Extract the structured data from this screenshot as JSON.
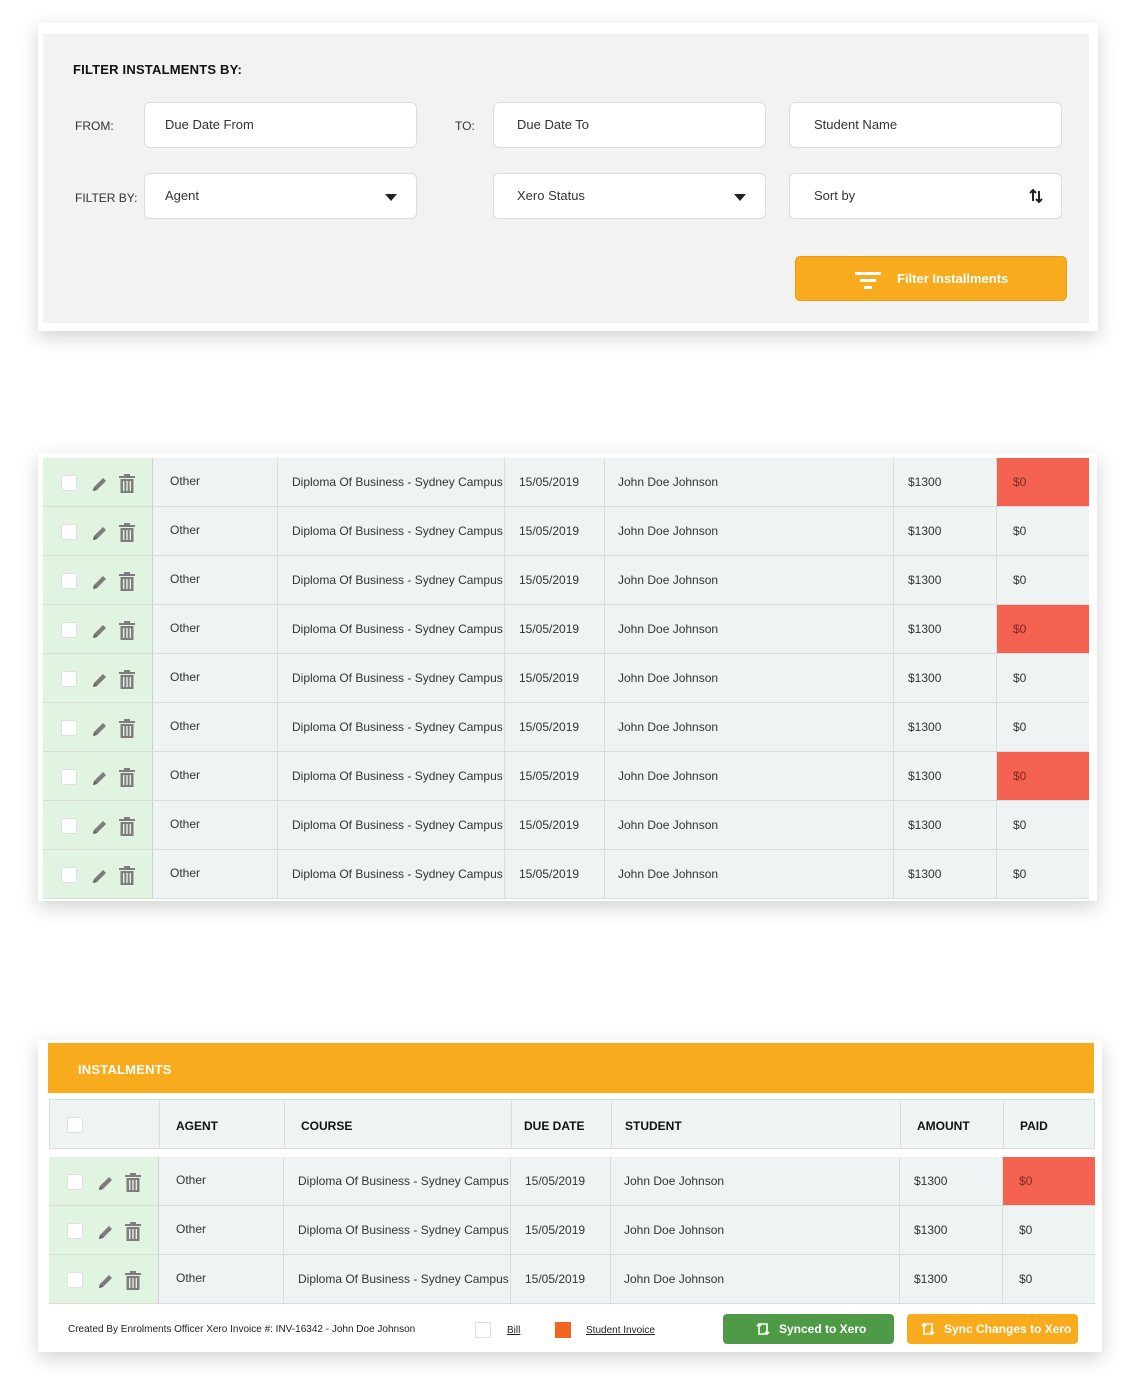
{
  "filter": {
    "heading": "FILTER INSTALMENTS BY:",
    "from_label": "FROM:",
    "to_label": "TO:",
    "filter_by_label": "FILTER BY:",
    "due_date_from": "Due Date From",
    "due_date_to": "Due Date To",
    "student_name": "Student Name",
    "agent": "Agent",
    "xero_status": "Xero Status",
    "sort_by": "Sort by",
    "button": "Filter Installments"
  },
  "table1": {
    "rows": [
      {
        "agent": "Other",
        "course": "Diploma Of Business - Sydney Campus",
        "due": "15/05/2019",
        "student": "John Doe Johnson",
        "amount": "$1300",
        "paid": "$0",
        "paid_alert": true
      },
      {
        "agent": "Other",
        "course": "Diploma Of Business - Sydney Campus",
        "due": "15/05/2019",
        "student": "John Doe Johnson",
        "amount": "$1300",
        "paid": "$0",
        "paid_alert": false
      },
      {
        "agent": "Other",
        "course": "Diploma Of Business - Sydney Campus",
        "due": "15/05/2019",
        "student": "John Doe Johnson",
        "amount": "$1300",
        "paid": "$0",
        "paid_alert": false
      },
      {
        "agent": "Other",
        "course": "Diploma Of Business - Sydney Campus",
        "due": "15/05/2019",
        "student": "John Doe Johnson",
        "amount": "$1300",
        "paid": "$0",
        "paid_alert": true
      },
      {
        "agent": "Other",
        "course": "Diploma Of Business - Sydney Campus",
        "due": "15/05/2019",
        "student": "John Doe Johnson",
        "amount": "$1300",
        "paid": "$0",
        "paid_alert": false
      },
      {
        "agent": "Other",
        "course": "Diploma Of Business - Sydney Campus",
        "due": "15/05/2019",
        "student": "John Doe Johnson",
        "amount": "$1300",
        "paid": "$0",
        "paid_alert": false
      },
      {
        "agent": "Other",
        "course": "Diploma Of Business - Sydney Campus",
        "due": "15/05/2019",
        "student": "John Doe Johnson",
        "amount": "$1300",
        "paid": "$0",
        "paid_alert": true
      },
      {
        "agent": "Other",
        "course": "Diploma Of Business - Sydney Campus",
        "due": "15/05/2019",
        "student": "John Doe Johnson",
        "amount": "$1300",
        "paid": "$0",
        "paid_alert": false
      },
      {
        "agent": "Other",
        "course": "Diploma Of Business - Sydney Campus",
        "due": "15/05/2019",
        "student": "John Doe Johnson",
        "amount": "$1300",
        "paid": "$0",
        "paid_alert": false
      }
    ]
  },
  "table2": {
    "title": "INSTALMENTS",
    "headers": {
      "agent": "AGENT",
      "course": "COURSE",
      "due": "DUE DATE",
      "student": "STUDENT",
      "amount": "AMOUNT",
      "paid": "PAID"
    },
    "rows": [
      {
        "agent": "Other",
        "course": "Diploma Of Business - Sydney Campus",
        "due": "15/05/2019",
        "student": "John Doe Johnson",
        "amount": "$1300",
        "paid": "$0",
        "paid_alert": true
      },
      {
        "agent": "Other",
        "course": "Diploma Of Business - Sydney Campus",
        "due": "15/05/2019",
        "student": "John Doe Johnson",
        "amount": "$1300",
        "paid": "$0",
        "paid_alert": false
      },
      {
        "agent": "Other",
        "course": "Diploma Of Business - Sydney Campus",
        "due": "15/05/2019",
        "student": "John Doe Johnson",
        "amount": "$1300",
        "paid": "$0",
        "paid_alert": false
      }
    ],
    "footer": {
      "note": "Created By Enrolments Officer Xero Invoice #: INV-16342 - John Doe Johnson",
      "legend_bill": "Bill",
      "legend_student_invoice": "Student Invoice",
      "synced_button": "Synced to Xero",
      "sync_button": "Sync Changes to Xero"
    }
  },
  "colors": {
    "accent": "#f9ab1e",
    "alert": "#f46352",
    "success": "#4f9a47",
    "action_cell": "#e1f4e1",
    "row_bg": "#eef4f4",
    "legend_student_invoice": "#f06424"
  },
  "icons": [
    "edit-icon",
    "trash-icon",
    "filter-icon",
    "sort-icon",
    "dropdown-caret-icon",
    "sync-icon"
  ]
}
